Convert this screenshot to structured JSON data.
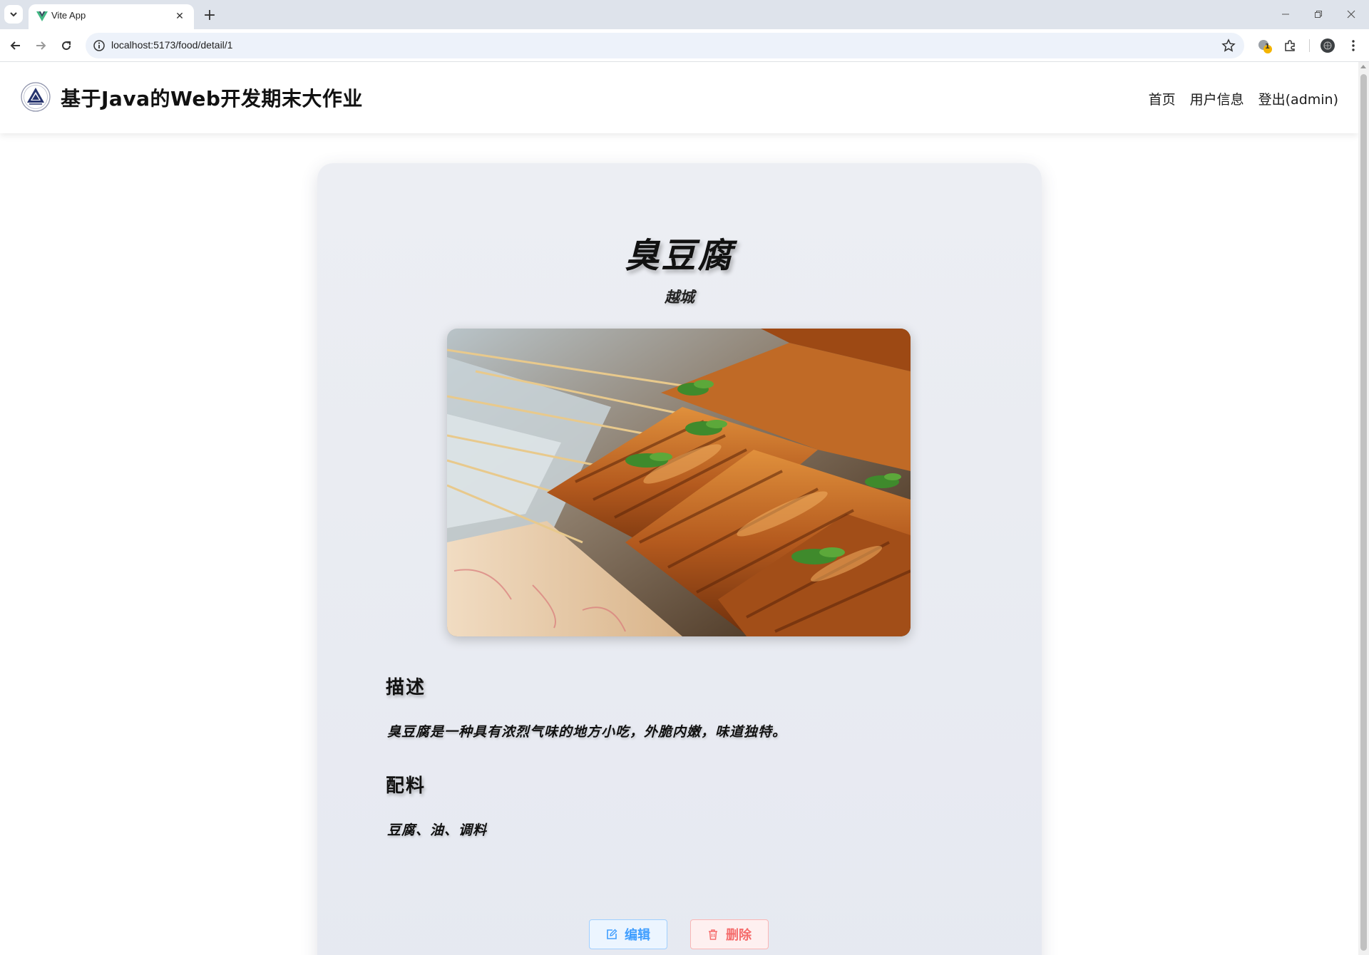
{
  "browser": {
    "tab_title": "Vite App",
    "tab_close": "✕",
    "new_tab": "+",
    "url": "localhost:5173/food/detail/1",
    "window_controls": {
      "minimize": "—",
      "restore": "❐",
      "close": "✕"
    },
    "extension_badge": "1"
  },
  "header": {
    "title": "基于Java的Web开发期末大作业",
    "nav": {
      "home": "首页",
      "user_info": "用户信息",
      "logout": "登出(admin)"
    }
  },
  "food": {
    "name": "臭豆腐",
    "region": "越城",
    "image_alt": "臭豆腐",
    "description_heading": "描述",
    "description": "臭豆腐是一种具有浓烈气味的地方小吃，外脆内嫩，味道独特。",
    "ingredients_heading": "配料",
    "ingredients": "豆腐、油、调料"
  },
  "actions": {
    "edit_label": "编辑",
    "delete_label": "删除"
  },
  "colors": {
    "edit": "#409eff",
    "delete": "#f56c6c",
    "vue_green": "#41b883",
    "vue_dark": "#35495e"
  }
}
